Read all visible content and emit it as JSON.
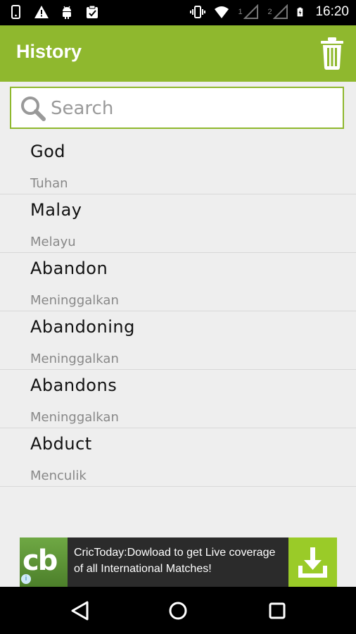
{
  "status_bar": {
    "time": "16:20",
    "sim1": "1",
    "sim2": "2",
    "icons": [
      "phone-icon",
      "warning-icon",
      "android-icon",
      "clipboard-icon",
      "vibrate-icon",
      "wifi-icon",
      "signal-icon",
      "signal-icon",
      "battery-icon"
    ]
  },
  "app_bar": {
    "title": "History",
    "action_icon": "trash-icon",
    "color": "#8fb82e"
  },
  "search": {
    "placeholder": "Search",
    "value": ""
  },
  "history": [
    {
      "word": "God",
      "meaning": "Tuhan"
    },
    {
      "word": "Malay",
      "meaning": "Melayu"
    },
    {
      "word": "Abandon",
      "meaning": "Meninggalkan"
    },
    {
      "word": "Abandoning",
      "meaning": "Meninggalkan"
    },
    {
      "word": "Abandons",
      "meaning": "Meninggalkan"
    },
    {
      "word": "Abduct",
      "meaning": "Menculik"
    }
  ],
  "ad": {
    "logo_text": "cb",
    "text": "CricToday:Dowload to get Live coverage of all International Matches!",
    "action_icon": "download-icon"
  },
  "nav_bar": {
    "icons": [
      "back-icon",
      "home-icon",
      "recents-icon"
    ]
  }
}
